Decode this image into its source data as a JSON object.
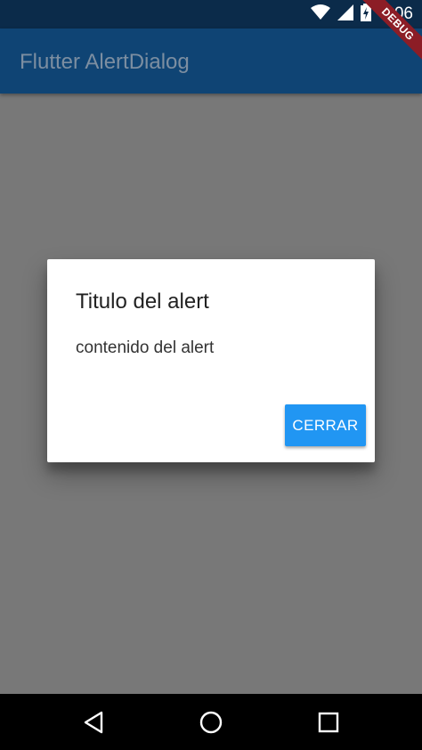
{
  "status_bar": {
    "time": "4:06",
    "icons": [
      "wifi-icon",
      "cell-signal-icon",
      "battery-charging-icon"
    ]
  },
  "debug_banner": {
    "label": "DEBUG"
  },
  "app_bar": {
    "title": "Flutter AlertDialog"
  },
  "dialog": {
    "title": "Titulo del alert",
    "content": "contenido del alert",
    "button_label": "CERRAR"
  },
  "nav_bar": {
    "icons": [
      "back-icon",
      "home-icon",
      "recents-icon"
    ]
  },
  "colors": {
    "status_bar": "#0b2b4a",
    "app_bar": "#0f4474",
    "scrim": "#787878",
    "button": "#2196f3",
    "debug_banner": "#8c1d26"
  }
}
